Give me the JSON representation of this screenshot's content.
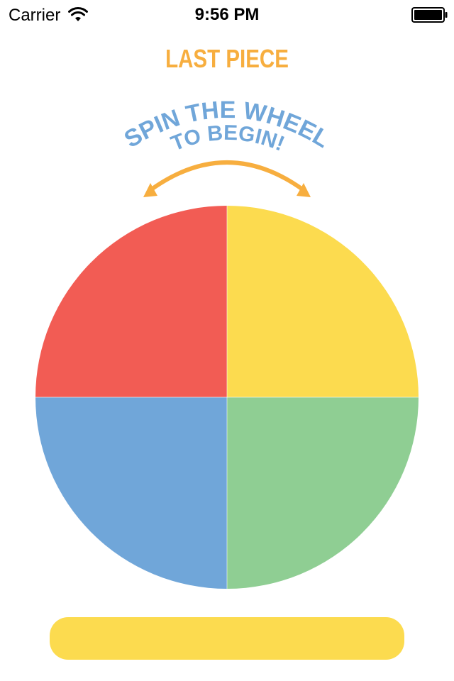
{
  "status_bar": {
    "carrier": "Carrier",
    "time": "9:56 PM",
    "wifi_icon": "wifi-icon",
    "battery_icon": "battery-icon"
  },
  "header": {
    "title": "LAST PIECE"
  },
  "instruction": {
    "line1": "SPIN THE WHEEL",
    "line2": "TO BEGIN!",
    "arrow_icon": "curved-double-arrow-icon"
  },
  "wheel": {
    "segments": [
      {
        "position": "top-left",
        "color": "#f25c54"
      },
      {
        "position": "top-right",
        "color": "#fcdb4f"
      },
      {
        "position": "bottom-right",
        "color": "#8fce93"
      },
      {
        "position": "bottom-left",
        "color": "#70a6d9"
      }
    ]
  },
  "spin_button": {
    "label": ""
  },
  "colors": {
    "title": "#f7ae3f",
    "instruction": "#70a6d9",
    "arrow": "#f7ae3f",
    "button": "#fcdb4f"
  }
}
